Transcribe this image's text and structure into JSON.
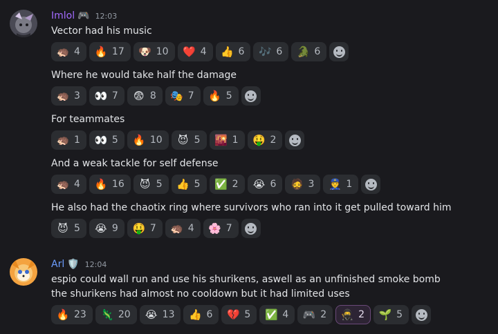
{
  "messages": [
    {
      "author": {
        "name": "Imlol",
        "name_color": "#a36bff",
        "badge": "🎮",
        "time": "12:03"
      },
      "lines": [
        {
          "text": "Vector had his music",
          "reactions": [
            {
              "emoji": "sonic-custom-emoji",
              "glyph": "🦔",
              "count": "4"
            },
            {
              "emoji": "fire-emoji",
              "glyph": "🔥",
              "count": "17"
            },
            {
              "emoji": "dog-meme-custom-emoji",
              "glyph": "🐶",
              "count": "10"
            },
            {
              "emoji": "red-heart-emoji",
              "glyph": "❤️",
              "count": "4"
            },
            {
              "emoji": "thumbs-up-emoji",
              "glyph": "👍",
              "count": "6"
            },
            {
              "emoji": "musical-notes-emoji",
              "glyph": "🎶",
              "count": "6"
            },
            {
              "emoji": "vector-dancing-custom-emoji",
              "glyph": "🐊",
              "count": "6"
            }
          ]
        },
        {
          "text": "Where he would take half the damage",
          "reactions": [
            {
              "emoji": "sonic-custom-emoji",
              "glyph": "🦔",
              "count": "3"
            },
            {
              "emoji": "eyes-emoji",
              "glyph": "👀",
              "count": "7"
            },
            {
              "emoji": "anxious-face-emoji",
              "glyph": "😨",
              "count": "8"
            },
            {
              "emoji": "pixel-character-custom-emoji",
              "glyph": "🎭",
              "count": "7"
            },
            {
              "emoji": "fire-emoji",
              "glyph": "🔥",
              "count": "5"
            }
          ]
        },
        {
          "text": "For teammates",
          "reactions": [
            {
              "emoji": "sonic-custom-emoji",
              "glyph": "🦔",
              "count": "1"
            },
            {
              "emoji": "eyes-emoji",
              "glyph": "👀",
              "count": "5"
            },
            {
              "emoji": "fire-emoji",
              "glyph": "🔥",
              "count": "10"
            },
            {
              "emoji": "dark-creature-custom-emoji",
              "glyph": "😈",
              "count": "5"
            },
            {
              "emoji": "sunset-custom-emoji",
              "glyph": "🌇",
              "count": "1"
            },
            {
              "emoji": "money-mouth-face-emoji",
              "glyph": "🤑",
              "count": "2"
            }
          ]
        },
        {
          "text": "And a weak tackle for self defense",
          "reactions": [
            {
              "emoji": "sonic-custom-emoji",
              "glyph": "🦔",
              "count": "4"
            },
            {
              "emoji": "fire-emoji",
              "glyph": "🔥",
              "count": "16"
            },
            {
              "emoji": "dark-creature-custom-emoji",
              "glyph": "😈",
              "count": "5"
            },
            {
              "emoji": "thumbs-up-emoji",
              "glyph": "👍",
              "count": "5"
            },
            {
              "emoji": "check-mark-emoji",
              "glyph": "✅",
              "count": "2"
            },
            {
              "emoji": "loudly-crying-face-emoji",
              "glyph": "😭",
              "count": "6"
            },
            {
              "emoji": "photo-face-custom-emoji",
              "glyph": "🧔",
              "count": "3"
            },
            {
              "emoji": "police-character-custom-emoji",
              "glyph": "👮",
              "count": "1"
            }
          ]
        },
        {
          "text": "He also had the chaotix ring where survivors who ran into it get pulled toward him",
          "reactions": [
            {
              "emoji": "dark-creature-custom-emoji",
              "glyph": "😈",
              "count": "5"
            },
            {
              "emoji": "loudly-crying-face-emoji",
              "glyph": "😭",
              "count": "9"
            },
            {
              "emoji": "money-mouth-face-emoji",
              "glyph": "🤑",
              "count": "7"
            },
            {
              "emoji": "sonic-custom-emoji",
              "glyph": "🦔",
              "count": "4"
            },
            {
              "emoji": "pink-character-custom-emoji",
              "glyph": "🌸",
              "count": "7"
            }
          ]
        }
      ]
    },
    {
      "author": {
        "name": "Arl",
        "name_color": "#6d9eff",
        "badge": "🛡️",
        "time": "12:04"
      },
      "lines": [
        {
          "text": "espio could wall run and use his shurikens, aswell as an unfinished smoke bomb",
          "reactions": []
        },
        {
          "text": "the shurikens had almost no cooldown but it had limited uses",
          "reactions": [
            {
              "emoji": "fire-emoji",
              "glyph": "🔥",
              "count": "23"
            },
            {
              "emoji": "purple-character-custom-emoji",
              "glyph": "🦎",
              "count": "20"
            },
            {
              "emoji": "loudly-crying-face-emoji",
              "glyph": "😭",
              "count": "13"
            },
            {
              "emoji": "thumbs-up-emoji",
              "glyph": "👍",
              "count": "6"
            },
            {
              "emoji": "broken-heart-emoji",
              "glyph": "💔",
              "count": "5"
            },
            {
              "emoji": "check-mark-emoji",
              "glyph": "✅",
              "count": "4"
            },
            {
              "emoji": "game-controller-custom-emoji",
              "glyph": "🎮",
              "count": "2"
            },
            {
              "emoji": "espio-custom-emoji",
              "glyph": "🥷",
              "count": "2",
              "active": true
            },
            {
              "emoji": "plant-custom-emoji",
              "glyph": "🌱",
              "count": "5"
            }
          ]
        }
      ]
    }
  ]
}
